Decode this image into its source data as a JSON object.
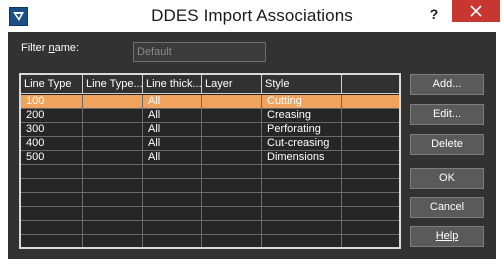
{
  "window": {
    "title": "DDES Import Associations",
    "help_label": "?"
  },
  "filter": {
    "label": "Filter name:",
    "placeholder": "Default"
  },
  "grid": {
    "columns": [
      "Line Type",
      "Line Type...",
      "Line thick...",
      "Layer",
      "Style",
      ""
    ],
    "rows": [
      {
        "line_type": "100",
        "line_type_2": "",
        "line_thick": "All",
        "layer": "",
        "style": "Cutting"
      },
      {
        "line_type": "200",
        "line_type_2": "",
        "line_thick": "All",
        "layer": "",
        "style": "Creasing"
      },
      {
        "line_type": "300",
        "line_type_2": "",
        "line_thick": "All",
        "layer": "",
        "style": "Perforating"
      },
      {
        "line_type": "400",
        "line_type_2": "",
        "line_thick": "All",
        "layer": "",
        "style": "Cut-creasing"
      },
      {
        "line_type": "500",
        "line_type_2": "",
        "line_thick": "All",
        "layer": "",
        "style": "Dimensions"
      }
    ],
    "selected_row": 0
  },
  "buttons": {
    "add": "Add...",
    "edit": "Edit...",
    "delete": "Delete",
    "ok": "OK",
    "cancel": "Cancel",
    "help": "Help"
  },
  "colors": {
    "selection": "#f0a35c",
    "close_button": "#c7372f",
    "dialog_bg": "#323232"
  }
}
